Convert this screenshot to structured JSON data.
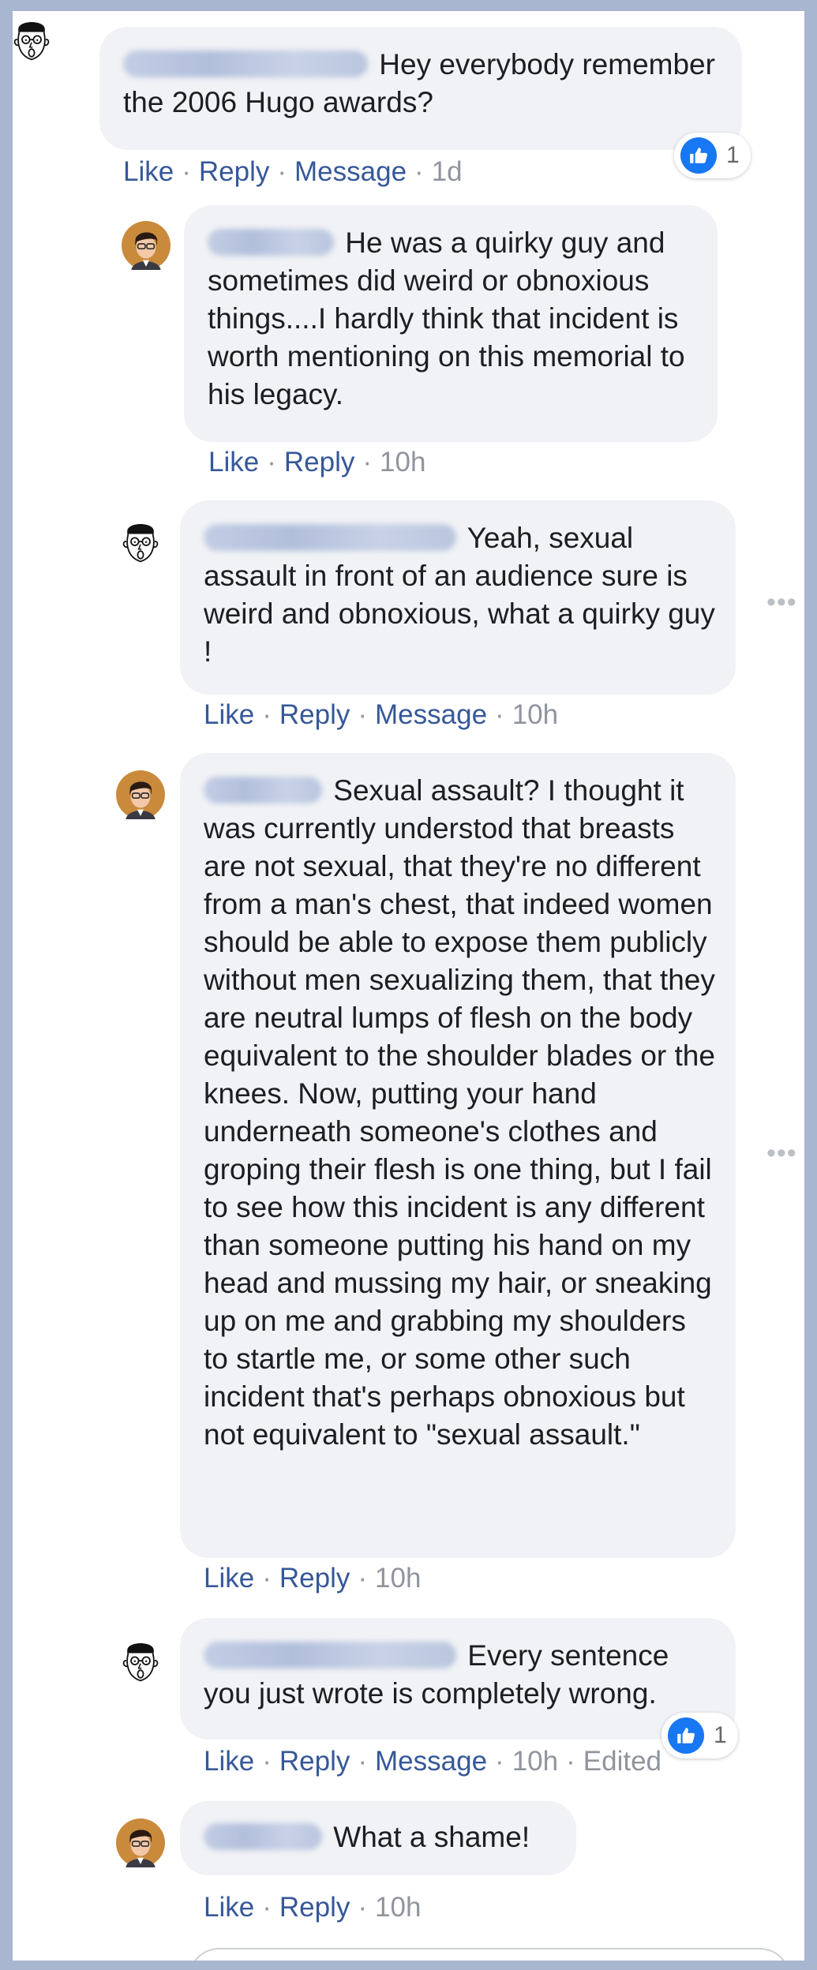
{
  "comments": [
    {
      "text": "Hey everybody remember the 2006 Hugo awards?",
      "actions": {
        "like": "Like",
        "reply": "Reply",
        "message": "Message",
        "time": "1d"
      },
      "reactions": "1"
    },
    {
      "text": "He was a quirky guy and sometimes did weird or obnoxious things....I hardly think that incident is worth mentioning on this memorial to his legacy.",
      "actions": {
        "like": "Like",
        "reply": "Reply",
        "time": "10h"
      }
    },
    {
      "text": "Yeah, sexual assault in front of an audience sure is weird and obnoxious, what a quirky guy !",
      "actions": {
        "like": "Like",
        "reply": "Reply",
        "message": "Message",
        "time": "10h"
      }
    },
    {
      "text": "Sexual assault? I thought it was currently understod that breasts are not sexual, that they're no different from a man's chest, that indeed women should be able to expose them publicly without men sexualizing them, that they are neutral lumps of flesh on the body equivalent to the shoulder blades or the knees. Now, putting your hand underneath someone's clothes and groping their flesh is one thing, but I fail to see how this incident is any different than someone putting his hand on my head and mussing my hair, or sneaking up on me and grabbing my shoulders to startle me, or some other such incident that's perhaps obnoxious but not equivalent to \"sexual assault.\"",
      "actions": {
        "like": "Like",
        "reply": "Reply",
        "time": "10h"
      }
    },
    {
      "text": "Every sentence you just wrote is completely wrong.",
      "actions": {
        "like": "Like",
        "reply": "Reply",
        "message": "Message",
        "time": "10h",
        "edited": "Edited"
      },
      "reactions": "1"
    },
    {
      "text": "What a shame!",
      "actions": {
        "like": "Like",
        "reply": "Reply",
        "time": "10h"
      }
    }
  ],
  "icons": {
    "avatar_sketch": "sketch-face-avatar",
    "avatar_photo": "photo-avatar",
    "like_reaction": "thumbs-up-icon",
    "more_options": "more-options-icon"
  },
  "colors": {
    "link": "#365899",
    "bubble": "#f0f2f5",
    "like_blue": "#1877f2",
    "frame": "#a9b6cf"
  },
  "more_glyph": "•••",
  "separator": "·"
}
